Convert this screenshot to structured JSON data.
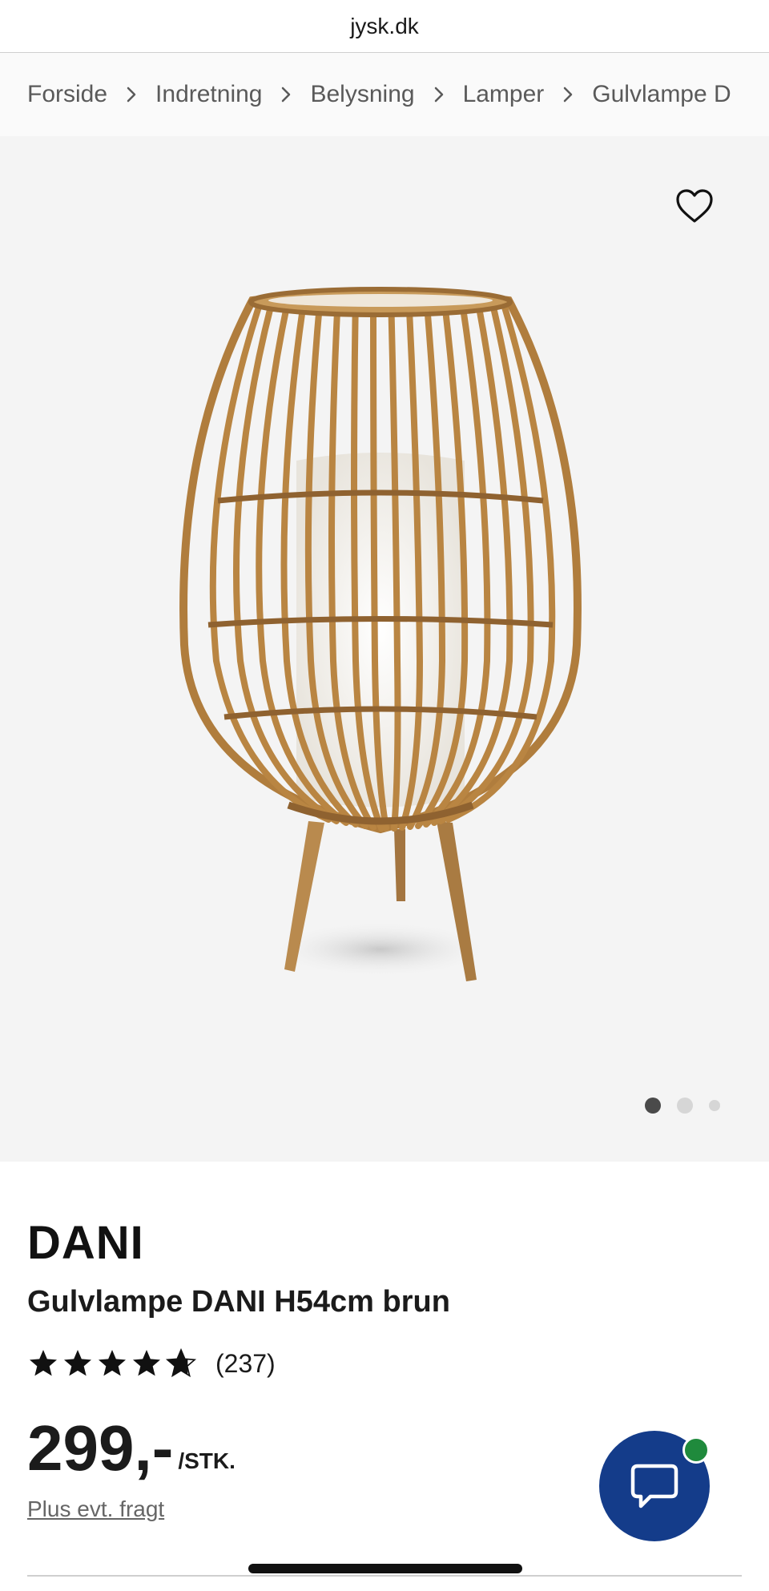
{
  "browser": {
    "url": "jysk.dk"
  },
  "breadcrumb": {
    "items": [
      "Forside",
      "Indretning",
      "Belysning",
      "Lamper",
      "Gulvlampe D"
    ]
  },
  "gallery": {
    "image_count": 3,
    "active_index": 0
  },
  "product": {
    "brand": "DANI",
    "name": "Gulvlampe DANI H54cm brun",
    "rating": 4.7,
    "reviews": "(237)",
    "price": "299,-",
    "price_unit": "/STK.",
    "shipping_note": "Plus evt. fragt"
  },
  "icons": {
    "wishlist": "heart-icon",
    "chat": "chat-bubble-icon",
    "breadcrumb_separator": "chevron-right-icon",
    "rating": "star-icon"
  },
  "colors": {
    "chat_button": "#143c8a",
    "online_status": "#1f8a3c",
    "gallery_bg": "#f4f4f4"
  }
}
